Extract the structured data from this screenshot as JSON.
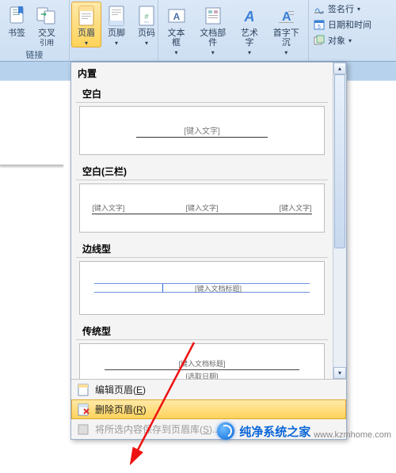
{
  "ribbon": {
    "groups": {
      "links": {
        "label": "链接",
        "bookmark": "书签",
        "cross_ref_l1": "交叉",
        "cross_ref_l2": "引用"
      },
      "header_footer": {
        "header_l1": "页眉",
        "footer_l1": "页脚",
        "pagenum_l1": "页码"
      },
      "text": {
        "textbox": "文本框",
        "quickparts": "文档部件",
        "wordart": "艺术字",
        "dropcap": "首字下沉"
      },
      "misc": {
        "signature": "签名行",
        "datetime": "日期和时间",
        "object": "对象"
      }
    }
  },
  "gallery": {
    "heading": "内置",
    "sections": {
      "blank": {
        "title": "空白",
        "placeholder": "[键入文字]"
      },
      "blank3": {
        "title": "空白(三栏)",
        "p1": "[键入文字]",
        "p2": "[键入文字]",
        "p3": "[键入文字]"
      },
      "edge": {
        "title": "边线型",
        "placeholder": "[键入文档标题]"
      },
      "traditional": {
        "title": "传统型",
        "p1": "[键入文档标题]",
        "p2": "[选取日期]"
      }
    },
    "footer": {
      "edit": {
        "text": "编辑页眉(",
        "key": "E",
        "suffix": ")"
      },
      "remove": {
        "text": "删除页眉(",
        "key": "R",
        "suffix": ")"
      },
      "save": {
        "text": "将所选内容保存到页眉库(",
        "key": "S",
        "suffix": ")..."
      }
    }
  },
  "watermark": {
    "brand": "纯净系统之家",
    "url": "www.kzmhome.com"
  }
}
